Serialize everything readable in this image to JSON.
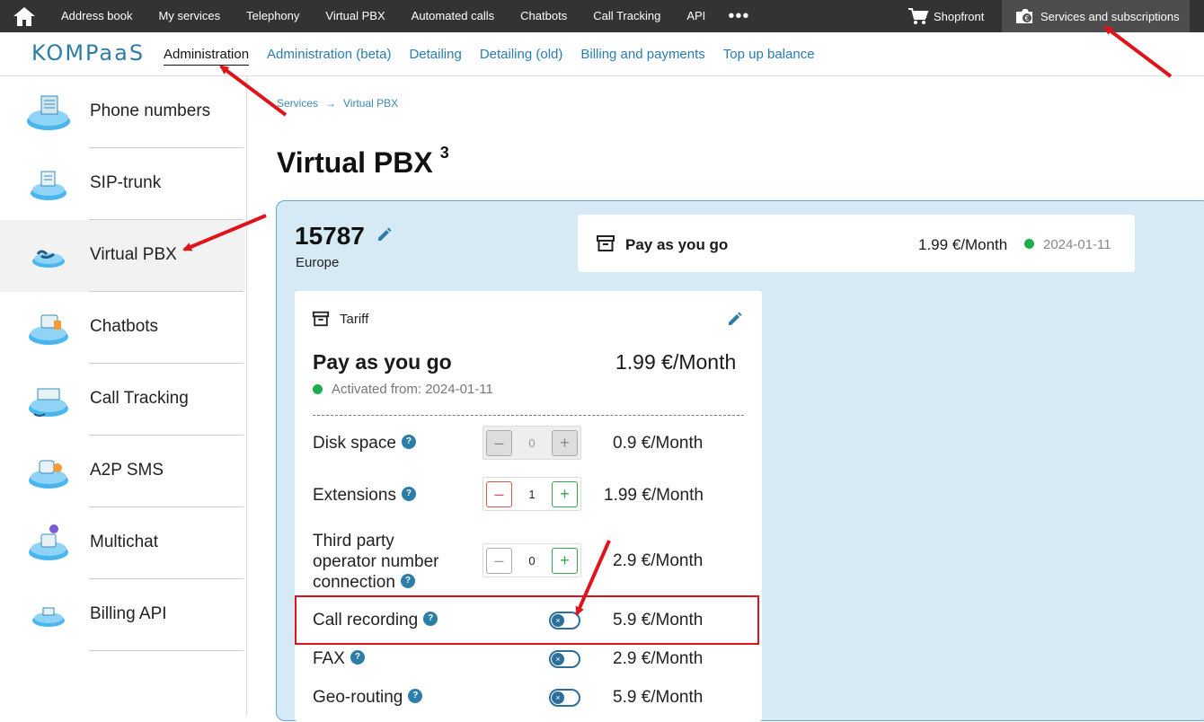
{
  "topbar": {
    "items": [
      "Address book",
      "My services",
      "Telephony",
      "Virtual PBX",
      "Automated calls",
      "Chatbots",
      "Call Tracking",
      "API"
    ],
    "more": "•••",
    "shopfront": "Shopfront",
    "subscriptions": "Services and subscriptions"
  },
  "logo": "KOMPaaS",
  "subnav": [
    "Administration",
    "Administration (beta)",
    "Detailing",
    "Detailing (old)",
    "Billing and payments",
    "Top up balance"
  ],
  "sidebar": [
    "Phone numbers",
    "SIP-trunk",
    "Virtual PBX",
    "Chatbots",
    "Call Tracking",
    "A2P SMS",
    "Multichat",
    "Billing API"
  ],
  "breadcrumb": {
    "first": "Services",
    "arrow": "→",
    "second": "Virtual PBX"
  },
  "page": {
    "title": "Virtual PBX",
    "count": "3"
  },
  "pbx": {
    "id": "15787",
    "region": "Europe"
  },
  "tariff_summary": {
    "name": "Pay as you go",
    "price": "1.99 €/Month",
    "date": "2024-01-11"
  },
  "tariff_card": {
    "label": "Tariff",
    "name": "Pay as you go",
    "price": "1.99 €/Month",
    "activated": "Activated from: 2024-01-11",
    "options": [
      {
        "name": "Disk space",
        "value": "0",
        "price": "0.9 €/Month"
      },
      {
        "name": "Extensions",
        "value": "1",
        "price": "1.99 €/Month"
      },
      {
        "name_lines": [
          "Third party",
          "operator number",
          "connection"
        ],
        "value": "0",
        "price": "2.9 €/Month"
      },
      {
        "name": "Call recording",
        "price": "5.9 €/Month"
      },
      {
        "name": "FAX",
        "price": "2.9 €/Month"
      },
      {
        "name": "Geo-routing",
        "price": "5.9 €/Month"
      }
    ],
    "help": "?",
    "minus": "–",
    "plus": "+",
    "toggle_off": "×"
  },
  "colors": {
    "accent": "#2c7ea8",
    "panel": "#d6eaf6",
    "active": "#1cad4c",
    "annotation": "#e0131a"
  }
}
